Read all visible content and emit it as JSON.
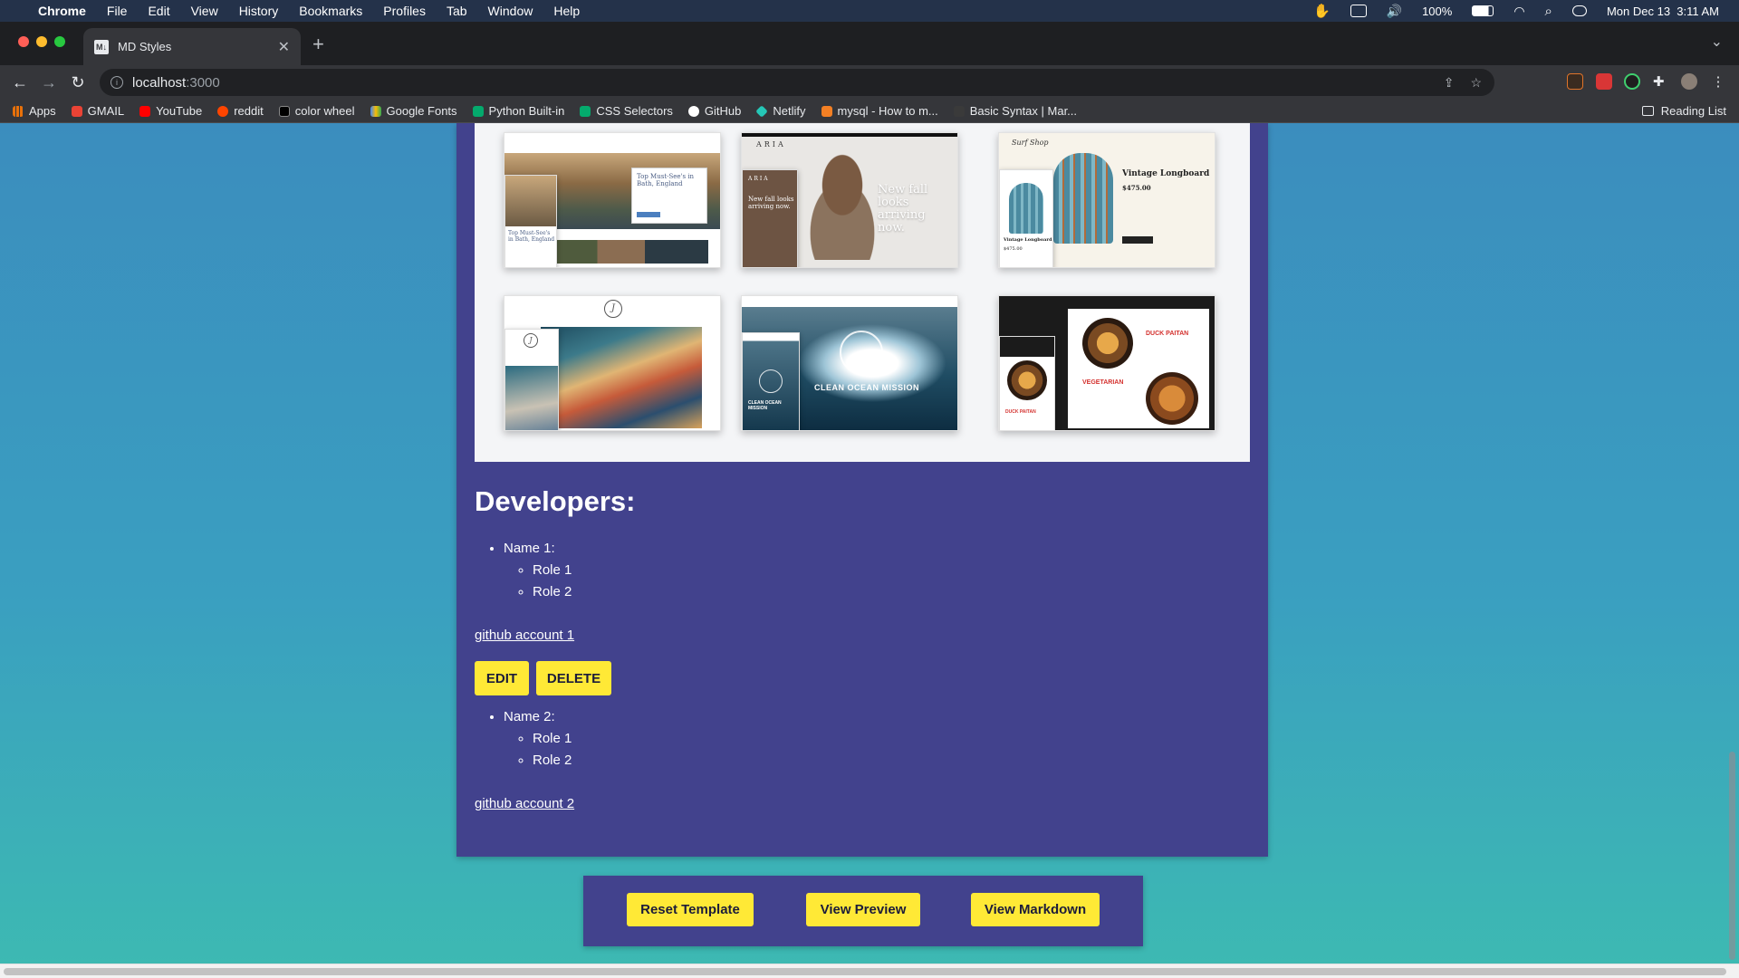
{
  "menubar": {
    "app": "Chrome",
    "items": [
      "File",
      "Edit",
      "View",
      "History",
      "Bookmarks",
      "Profiles",
      "Tab",
      "Window",
      "Help"
    ],
    "battery": "100%",
    "clock": "Mon Dec 13  3:11 AM"
  },
  "browser": {
    "tab_title": "MD Styles",
    "tab_favicon": "M↓",
    "url_host": "localhost",
    "url_port": ":3000",
    "bookmarks": [
      {
        "label": "Apps",
        "icon": "apps-grid-icon",
        "color": "#e8710a"
      },
      {
        "label": "GMAIL",
        "icon": "gmail-icon",
        "color": "#ea4335"
      },
      {
        "label": "YouTube",
        "icon": "youtube-icon",
        "color": "#ff0000"
      },
      {
        "label": "reddit",
        "icon": "reddit-icon",
        "color": "#ff4500"
      },
      {
        "label": "color wheel",
        "icon": "color-wheel-icon",
        "color": "#222222"
      },
      {
        "label": "Google Fonts",
        "icon": "google-fonts-icon",
        "color": "#4285f4"
      },
      {
        "label": "Python Built-in",
        "icon": "w3schools-icon",
        "color": "#04aa6d"
      },
      {
        "label": "CSS Selectors",
        "icon": "w3schools-icon",
        "color": "#04aa6d"
      },
      {
        "label": "GitHub",
        "icon": "github-icon",
        "color": "#ffffff"
      },
      {
        "label": "Netlify",
        "icon": "netlify-icon",
        "color": "#25c7b7"
      },
      {
        "label": "mysql - How to m...",
        "icon": "stackoverflow-icon",
        "color": "#f48024"
      },
      {
        "label": "Basic Syntax | Mar...",
        "icon": "markdown-guide-icon",
        "color": "#3a3a3a"
      }
    ],
    "reading_list": "Reading List"
  },
  "gallery": {
    "shots": [
      {
        "title": "Top Must-See's in Bath, England"
      },
      {
        "brand": "ARIA",
        "headline": "New fall looks arriving now."
      },
      {
        "brand": "Surf Shop",
        "title": "Vintage Longboard",
        "price": "$475.00",
        "mini_price": "$475.00"
      },
      {
        "brand": "J"
      },
      {
        "title": "CLEAN OCEAN MISSION"
      },
      {
        "titles": [
          "DUCK PAITAN",
          "VEGETARIAN"
        ]
      }
    ]
  },
  "developers": {
    "heading": "Developers:",
    "entries": [
      {
        "name": "Name 1:",
        "roles": [
          "Role 1",
          "Role 2"
        ],
        "link": "github account 1"
      },
      {
        "name": "Name 2:",
        "roles": [
          "Role 1",
          "Role 2"
        ],
        "link": "github account 2"
      }
    ],
    "edit_label": "EDIT",
    "delete_label": "DELETE"
  },
  "actions": {
    "reset": "Reset Template",
    "preview": "View Preview",
    "markdown": "View Markdown"
  },
  "colors": {
    "card": "#42428d",
    "button": "#ffe936",
    "gradient_top": "#3b8dbe",
    "gradient_bottom": "#3dbab2"
  }
}
